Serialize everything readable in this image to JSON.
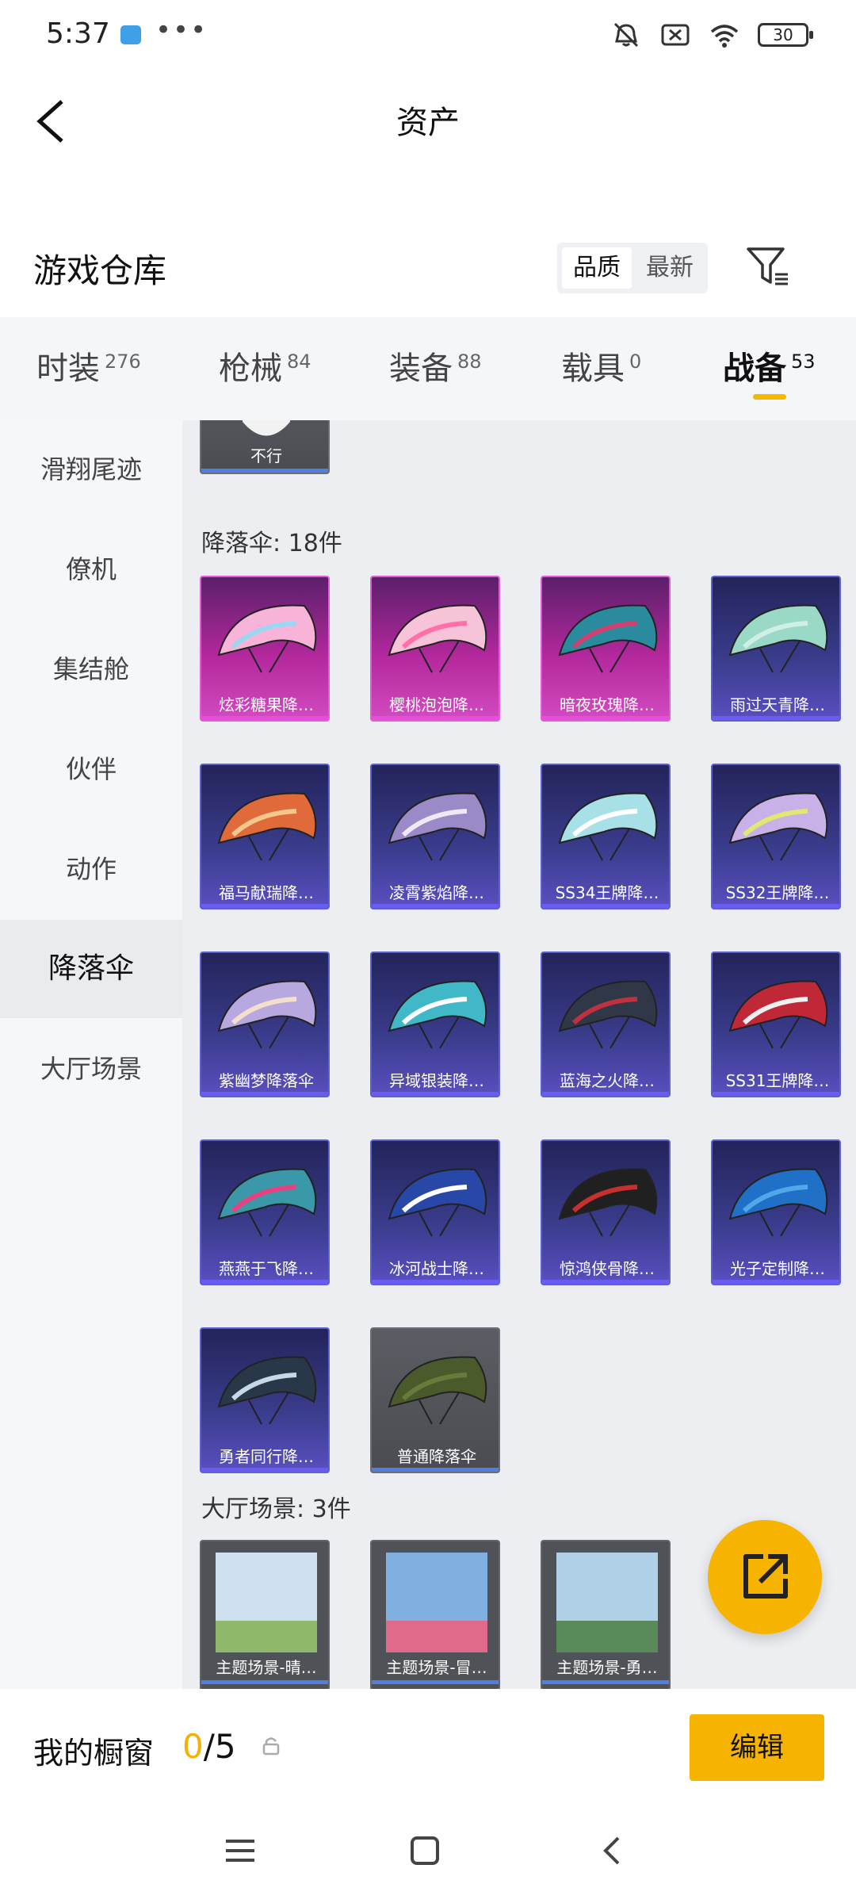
{
  "status_bar": {
    "time": "5:37",
    "dots": "•••",
    "battery": "30"
  },
  "header": {
    "title": "资产"
  },
  "warehouse": {
    "title": "游戏仓库",
    "sort_options": [
      "品质",
      "最新"
    ],
    "selected_sort": "品质"
  },
  "tabs": [
    {
      "label": "时装",
      "count": "276"
    },
    {
      "label": "枪械",
      "count": "84"
    },
    {
      "label": "装备",
      "count": "88"
    },
    {
      "label": "载具",
      "count": "0"
    },
    {
      "label": "战备",
      "count": "53",
      "active": true
    }
  ],
  "sidebar": {
    "items": [
      {
        "label": "滑翔尾迹"
      },
      {
        "label": "僚机"
      },
      {
        "label": "集结舱"
      },
      {
        "label": "伙伴"
      },
      {
        "label": "动作"
      },
      {
        "label": "降落伞",
        "active": true
      },
      {
        "label": "大厅场景"
      }
    ]
  },
  "content": {
    "partial_item_label": "不行",
    "parachute_section": "降落伞: 18件",
    "parachutes": [
      {
        "label": "炫彩糖果降…",
        "quality": "pink"
      },
      {
        "label": "樱桃泡泡降…",
        "quality": "pink"
      },
      {
        "label": "暗夜玫瑰降…",
        "quality": "pink"
      },
      {
        "label": "雨过天青降…",
        "quality": "purple"
      },
      {
        "label": "福马献瑞降…",
        "quality": "purple"
      },
      {
        "label": "凌霄紫焰降…",
        "quality": "purple"
      },
      {
        "label": "SS34王牌降…",
        "quality": "purple"
      },
      {
        "label": "SS32王牌降…",
        "quality": "purple"
      },
      {
        "label": "紫幽梦降落伞",
        "quality": "purple"
      },
      {
        "label": "异域银装降…",
        "quality": "purple"
      },
      {
        "label": "蓝海之火降…",
        "quality": "purple"
      },
      {
        "label": "SS31王牌降…",
        "quality": "purple"
      },
      {
        "label": "燕燕于飞降…",
        "quality": "purple"
      },
      {
        "label": "冰河战士降…",
        "quality": "purple"
      },
      {
        "label": "惊鸿侠骨降…",
        "quality": "purple"
      },
      {
        "label": "光子定制降…",
        "quality": "purple"
      },
      {
        "label": "勇者同行降…",
        "quality": "purple"
      },
      {
        "label": "普通降落伞",
        "quality": "gray"
      }
    ],
    "scene_section": "大厅场景: 3件",
    "scenes": [
      {
        "label": "主题场景-晴…"
      },
      {
        "label": "主题场景-冒…"
      },
      {
        "label": "主题场景-勇…"
      }
    ]
  },
  "bottom_bar": {
    "label": "我的橱窗",
    "current": "0",
    "total": "/5",
    "edit_label": "编辑"
  },
  "colors": {
    "accent": "#f6b400",
    "pink_quality": "#e34fd6",
    "purple_quality": "#6a5cf0",
    "gray_quality": "#4f7fe0"
  }
}
